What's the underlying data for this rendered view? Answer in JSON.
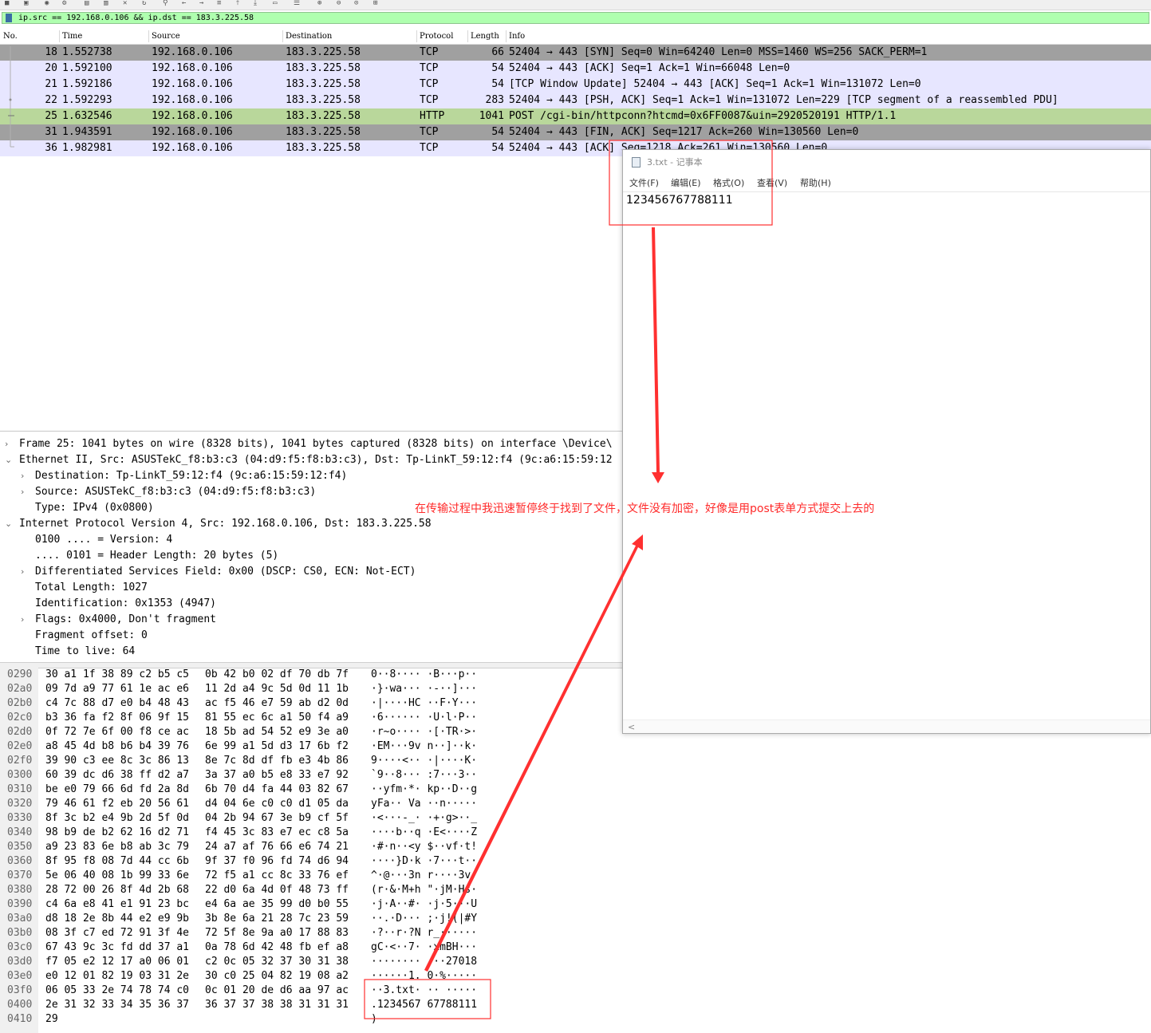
{
  "filter": {
    "value": "ip.src == 192.168.0.106 && ip.dst == 183.3.225.58"
  },
  "columns": {
    "no": "No.",
    "time": "Time",
    "source": "Source",
    "destination": "Destination",
    "protocol": "Protocol",
    "length": "Length",
    "info": "Info"
  },
  "packets": [
    {
      "no": "18",
      "time": "1.552738",
      "src": "192.168.0.106",
      "dst": "183.3.225.58",
      "proto": "TCP",
      "len": "66",
      "info": "52404 → 443 [SYN] Seq=0 Win=64240 Len=0 MSS=1460 WS=256 SACK_PERM=1",
      "bg": "#a0a0a0"
    },
    {
      "no": "20",
      "time": "1.592100",
      "src": "192.168.0.106",
      "dst": "183.3.225.58",
      "proto": "TCP",
      "len": "54",
      "info": "52404 → 443 [ACK] Seq=1 Ack=1 Win=66048 Len=0",
      "bg": "#e7e6ff"
    },
    {
      "no": "21",
      "time": "1.592186",
      "src": "192.168.0.106",
      "dst": "183.3.225.58",
      "proto": "TCP",
      "len": "54",
      "info": "[TCP Window Update] 52404 → 443 [ACK] Seq=1 Ack=1 Win=131072 Len=0",
      "bg": "#e7e6ff"
    },
    {
      "no": "22",
      "time": "1.592293",
      "src": "192.168.0.106",
      "dst": "183.3.225.58",
      "proto": "TCP",
      "len": "283",
      "info": "52404 → 443 [PSH, ACK] Seq=1 Ack=1 Win=131072 Len=229 [TCP segment of a reassembled PDU]",
      "bg": "#e7e6ff"
    },
    {
      "no": "25",
      "time": "1.632546",
      "src": "192.168.0.106",
      "dst": "183.3.225.58",
      "proto": "HTTP",
      "len": "1041",
      "info": "POST /cgi-bin/httpconn?htcmd=0x6FF0087&uin=2920520191 HTTP/1.1",
      "bg": "#b9d79b"
    },
    {
      "no": "31",
      "time": "1.943591",
      "src": "192.168.0.106",
      "dst": "183.3.225.58",
      "proto": "TCP",
      "len": "54",
      "info": "52404 → 443 [FIN, ACK] Seq=1217 Ack=260 Win=130560 Len=0",
      "bg": "#a0a0a0"
    },
    {
      "no": "36",
      "time": "1.982981",
      "src": "192.168.0.106",
      "dst": "183.3.225.58",
      "proto": "TCP",
      "len": "54",
      "info": "52404 → 443 [ACK] Seq=1218 Ack=261 Win=130560 Len=0",
      "bg": "#e7e6ff"
    }
  ],
  "details": [
    {
      "text": "Frame 25: 1041 bytes on wire (8328 bits), 1041 bytes captured (8328 bits) on interface \\Device\\",
      "level": 0,
      "arrow": "›"
    },
    {
      "text": "Ethernet II, Src: ASUSTekC_f8:b3:c3 (04:d9:f5:f8:b3:c3), Dst: Tp-LinkT_59:12:f4 (9c:a6:15:59:12",
      "level": 0,
      "arrow": "⌄"
    },
    {
      "text": "Destination: Tp-LinkT_59:12:f4 (9c:a6:15:59:12:f4)",
      "level": 1,
      "arrow": "›"
    },
    {
      "text": "Source: ASUSTekC_f8:b3:c3 (04:d9:f5:f8:b3:c3)",
      "level": 1,
      "arrow": "›"
    },
    {
      "text": "Type: IPv4 (0x0800)",
      "level": 1,
      "arrow": ""
    },
    {
      "text": "Internet Protocol Version 4, Src: 192.168.0.106, Dst: 183.3.225.58",
      "level": 0,
      "arrow": "⌄"
    },
    {
      "text": "0100 .... = Version: 4",
      "level": 1,
      "arrow": ""
    },
    {
      "text": ".... 0101 = Header Length: 20 bytes (5)",
      "level": 1,
      "arrow": ""
    },
    {
      "text": "Differentiated Services Field: 0x00 (DSCP: CS0, ECN: Not-ECT)",
      "level": 1,
      "arrow": "›"
    },
    {
      "text": "Total Length: 1027",
      "level": 1,
      "arrow": ""
    },
    {
      "text": "Identification: 0x1353 (4947)",
      "level": 1,
      "arrow": ""
    },
    {
      "text": "Flags: 0x4000, Don't fragment",
      "level": 1,
      "arrow": "›"
    },
    {
      "text": "Fragment offset: 0",
      "level": 1,
      "arrow": ""
    },
    {
      "text": "Time to live: 64",
      "level": 1,
      "arrow": ""
    }
  ],
  "hex": [
    {
      "off": "0290",
      "b1": "30 a1 1f 38 89 c2 b5 c5",
      "b2": "0b 42 b0 02 df 70 db 7f",
      "asc": "0··8···· ·B···p··"
    },
    {
      "off": "02a0",
      "b1": "09 7d a9 77 61 1e ac e6",
      "b2": "11 2d a4 9c 5d 0d 11 1b",
      "asc": "·}·wa··· ·-··]···"
    },
    {
      "off": "02b0",
      "b1": "c4 7c 88 d7 e0 b4 48 43",
      "b2": "ac f5 46 e7 59 ab d2 0d",
      "asc": "·|····HC ··F·Y···"
    },
    {
      "off": "02c0",
      "b1": "b3 36 fa f2 8f 06 9f 15",
      "b2": "81 55 ec 6c a1 50 f4 a9",
      "asc": "·6······ ·U·l·P··"
    },
    {
      "off": "02d0",
      "b1": "0f 72 7e 6f 00 f8 ce ac",
      "b2": "18 5b ad 54 52 e9 3e a0",
      "asc": "·r~o···· ·[·TR·>·"
    },
    {
      "off": "02e0",
      "b1": "a8 45 4d b8 b6 b4 39 76",
      "b2": "6e 99 a1 5d d3 17 6b f2",
      "asc": "·EM···9v n··]··k·"
    },
    {
      "off": "02f0",
      "b1": "39 90 c3 ee 8c 3c 86 13",
      "b2": "8e 7c 8d df fb e3 4b 86",
      "asc": "9····<·· ·|····K·"
    },
    {
      "off": "0300",
      "b1": "60 39 dc d6 38 ff d2 a7",
      "b2": "3a 37 a0 b5 e8 33 e7 92",
      "asc": "`9··8··· :7···3··"
    },
    {
      "off": "0310",
      "b1": "be e0 79 66 6d fd 2a 8d",
      "b2": "6b 70 d4 fa 44 03 82 67",
      "asc": "··yfm·*· kp··D··g"
    },
    {
      "off": "0320",
      "b1": "79 46 61 f2 eb 20 56 61",
      "b2": "d4 04 6e c0 c0 d1 05 da",
      "asc": "yFa·· Va ··n·····"
    },
    {
      "off": "0330",
      "b1": "8f 3c b2 e4 9b 2d 5f 0d",
      "b2": "04 2b 94 67 3e b9 cf 5f",
      "asc": "·<···-_· ·+·g>··_"
    },
    {
      "off": "0340",
      "b1": "98 b9 de b2 62 16 d2 71",
      "b2": "f4 45 3c 83 e7 ec c8 5a",
      "asc": "····b··q ·E<····Z"
    },
    {
      "off": "0350",
      "b1": "a9 23 83 6e b8 ab 3c 79",
      "b2": "24 a7 af 76 66 e6 74 21",
      "asc": "·#·n··<y $··vf·t!"
    },
    {
      "off": "0360",
      "b1": "8f 95 f8 08 7d 44 cc 6b",
      "b2": "9f 37 f0 96 fd 74 d6 94",
      "asc": "····}D·k ·7···t··"
    },
    {
      "off": "0370",
      "b1": "5e 06 40 08 1b 99 33 6e",
      "b2": "72 f5 a1 cc 8c 33 76 ef",
      "asc": "^·@···3n r····3v·"
    },
    {
      "off": "0380",
      "b1": "28 72 00 26 8f 4d 2b 68",
      "b2": "22 d0 6a 4d 0f 48 73 ff",
      "asc": "(r·&·M+h \"·jM·Hs·"
    },
    {
      "off": "0390",
      "b1": "c4 6a e8 41 e1 91 23 bc",
      "b2": "e4 6a ae 35 99 d0 b0 55",
      "asc": "·j·A··#· ·j·5···U"
    },
    {
      "off": "03a0",
      "b1": "d8 18 2e 8b 44 e2 e9 9b",
      "b2": "3b 8e 6a 21 28 7c 23 59",
      "asc": "··.·D··· ;·j!(|#Y"
    },
    {
      "off": "03b0",
      "b1": "08 3f c7 ed 72 91 3f 4e",
      "b2": "72 5f 8e 9a a0 17 88 83",
      "asc": "·?··r·?N r_······"
    },
    {
      "off": "03c0",
      "b1": "67 43 9c 3c fd dd 37 a1",
      "b2": "0a 78 6d 42 48 fb ef a8",
      "asc": "gC·<··7· ·xmBH···"
    },
    {
      "off": "03d0",
      "b1": "f7 05 e2 12 17 a0 06 01",
      "b2": "c2 0c 05 32 37 30 31 38",
      "asc": "········ ···27018"
    },
    {
      "off": "03e0",
      "b1": "e0 12 01 82 19 03 31 2e",
      "b2": "30 c0 25 04 82 19 08 a2",
      "asc": "······1. 0·%·····"
    },
    {
      "off": "03f0",
      "b1": "06 05 33 2e 74 78 74 c0",
      "b2": "0c 01 20 de d6 aa 97 ac",
      "asc": "··3.txt· ·· ·····"
    },
    {
      "off": "0400",
      "b1": "2e 31 32 33 34 35 36 37",
      "b2": "36 37 37 38 38 31 31 31",
      "asc": ".1234567 67788111"
    },
    {
      "off": "0410",
      "b1": "29",
      "b2": "",
      "asc": ")"
    }
  ],
  "notepad": {
    "title": "3.txt - 记事本",
    "menus": [
      "文件(F)",
      "编辑(E)",
      "格式(O)",
      "查看(V)",
      "帮助(H)"
    ],
    "content": "123456767788111",
    "scroll_left": "<"
  },
  "annotation": {
    "text": "在传输过程中我迅速暂停终于找到了文件，文件没有加密，好像是用post表单方式提交上去的",
    "color": "#ff2a2a"
  }
}
